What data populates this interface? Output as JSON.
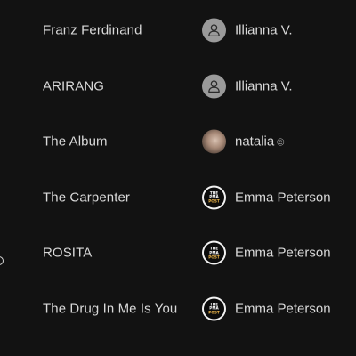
{
  "rows": [
    {
      "title": "Franz Ferdinand",
      "user": "Illianna V.",
      "avatar": "default-avatar-icon"
    },
    {
      "title": "ARIRANG",
      "user": "Illianna V.",
      "avatar": "default-avatar-icon"
    },
    {
      "title": "The Album",
      "user": "natalia",
      "badge": "©",
      "avatar": "photo"
    },
    {
      "title": "The Carpenter",
      "user": "Emma Peterson",
      "avatar": "logo"
    },
    {
      "title": "ROSITA",
      "user": "Emma Peterson",
      "avatar": "logo"
    },
    {
      "title": "The Drug In Me Is You",
      "user": "Emma Peterson",
      "avatar": "logo"
    }
  ],
  "logo": {
    "line1": "THE",
    "line2": "PMA",
    "line3": "POST"
  },
  "colors": {
    "background": "#121212",
    "text": "#d9d9d9",
    "default_avatar": "#9a9a9a"
  }
}
